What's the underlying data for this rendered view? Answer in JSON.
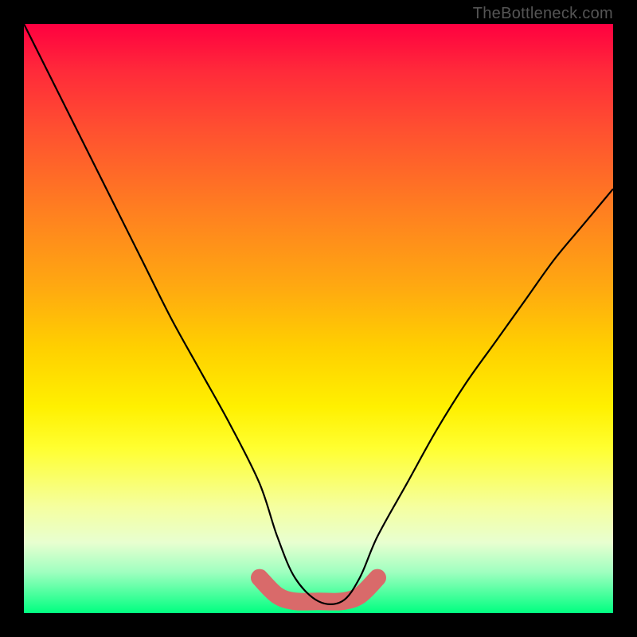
{
  "watermark": {
    "text": "TheBottleneck.com"
  },
  "chart_data": {
    "type": "line",
    "title": "",
    "xlabel": "",
    "ylabel": "",
    "xlim": [
      0,
      100
    ],
    "ylim": [
      0,
      100
    ],
    "series": [
      {
        "name": "bottleneck-curve",
        "x": [
          0,
          5,
          10,
          15,
          20,
          25,
          30,
          35,
          40,
          43,
          46,
          50,
          54,
          57,
          60,
          65,
          70,
          75,
          80,
          85,
          90,
          95,
          100
        ],
        "values": [
          100,
          90,
          80,
          70,
          60,
          50,
          41,
          32,
          22,
          13,
          6,
          2,
          2,
          6,
          13,
          22,
          31,
          39,
          46,
          53,
          60,
          66,
          72
        ]
      },
      {
        "name": "highlight-band",
        "x": [
          40,
          43,
          46,
          50,
          54,
          57,
          60
        ],
        "values": [
          6,
          3,
          2,
          2,
          2,
          3,
          6
        ]
      }
    ],
    "colors": {
      "curve": "#000000",
      "highlight": "#d96a6a",
      "gradient_top": "#ff0040",
      "gradient_bottom": "#00ff80"
    }
  }
}
